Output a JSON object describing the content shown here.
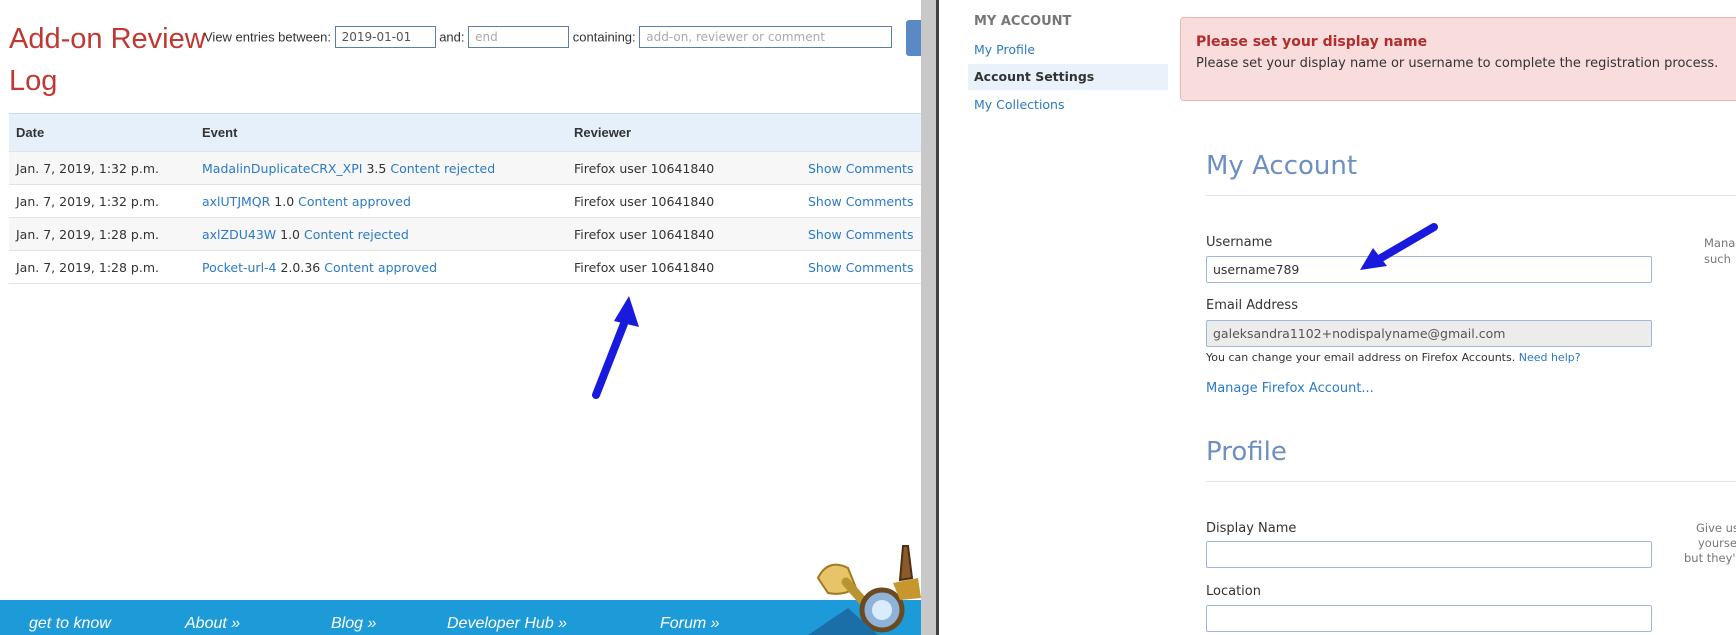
{
  "left_pane": {
    "title": "Add-on Review Log",
    "filters": {
      "between_label": "View entries between:",
      "start_value": "2019-01-01",
      "and_label": "and:",
      "end_placeholder": "end",
      "containing_label": "containing:",
      "search_placeholder": "add-on, reviewer or comment"
    },
    "table": {
      "headers": [
        "Date",
        "Event",
        "Reviewer",
        ""
      ],
      "rows": [
        {
          "date": "Jan. 7, 2019, 1:32 p.m.",
          "addon": "MadalinDuplicateCRX_XPI",
          "version": "3.5",
          "action": "Content rejected",
          "reviewer": "Firefox user 10641840",
          "comments": "Show Comments"
        },
        {
          "date": "Jan. 7, 2019, 1:32 p.m.",
          "addon": "axlUTJMQR",
          "version": "1.0",
          "action": "Content approved",
          "reviewer": "Firefox user 10641840",
          "comments": "Show Comments"
        },
        {
          "date": "Jan. 7, 2019, 1:28 p.m.",
          "addon": "axlZDU43W",
          "version": "1.0",
          "action": "Content rejected",
          "reviewer": "Firefox user 10641840",
          "comments": "Show Comments"
        },
        {
          "date": "Jan. 7, 2019, 1:28 p.m.",
          "addon": "Pocket-url-4",
          "version": "2.0.36",
          "action": "Content approved",
          "reviewer": "Firefox user 10641840",
          "comments": "Show Comments"
        }
      ]
    },
    "footer": {
      "items": [
        "get to know",
        "About »",
        "Blog »",
        "Developer Hub »",
        "Forum »"
      ]
    }
  },
  "right_pane": {
    "sidebar": {
      "heading": "MY ACCOUNT",
      "items": [
        {
          "label": "My Profile",
          "active": false
        },
        {
          "label": "Account Settings",
          "active": true
        },
        {
          "label": "My Collections",
          "active": false
        }
      ]
    },
    "alert": {
      "title": "Please set your display name",
      "body": "Please set your display name or username to complete the registration process."
    },
    "account": {
      "section_title": "My Account",
      "username_label": "Username",
      "username_value": "username789",
      "email_label": "Email Address",
      "email_value": "galeksandra1102+nodispalyname@gmail.com",
      "email_help": "You can change your email address on Firefox Accounts.",
      "email_help_link": "Need help?",
      "manage_link": "Manage Firefox Account...",
      "aside_line1": "Mana",
      "aside_line2": "such"
    },
    "profile": {
      "section_title": "Profile",
      "display_name_label": "Display Name",
      "display_name_value": "",
      "location_label": "Location",
      "location_value": "",
      "aside_line1": "Give us",
      "aside_line2": "yoursel",
      "aside_line3": "but they'l"
    }
  },
  "colors": {
    "title_red": "#c13832",
    "link_blue": "#2a7ac7",
    "footer_blue": "#1d9bd9",
    "annotation_arrow": "#1a1adf",
    "section_title_blue": "#6f8ec2"
  }
}
